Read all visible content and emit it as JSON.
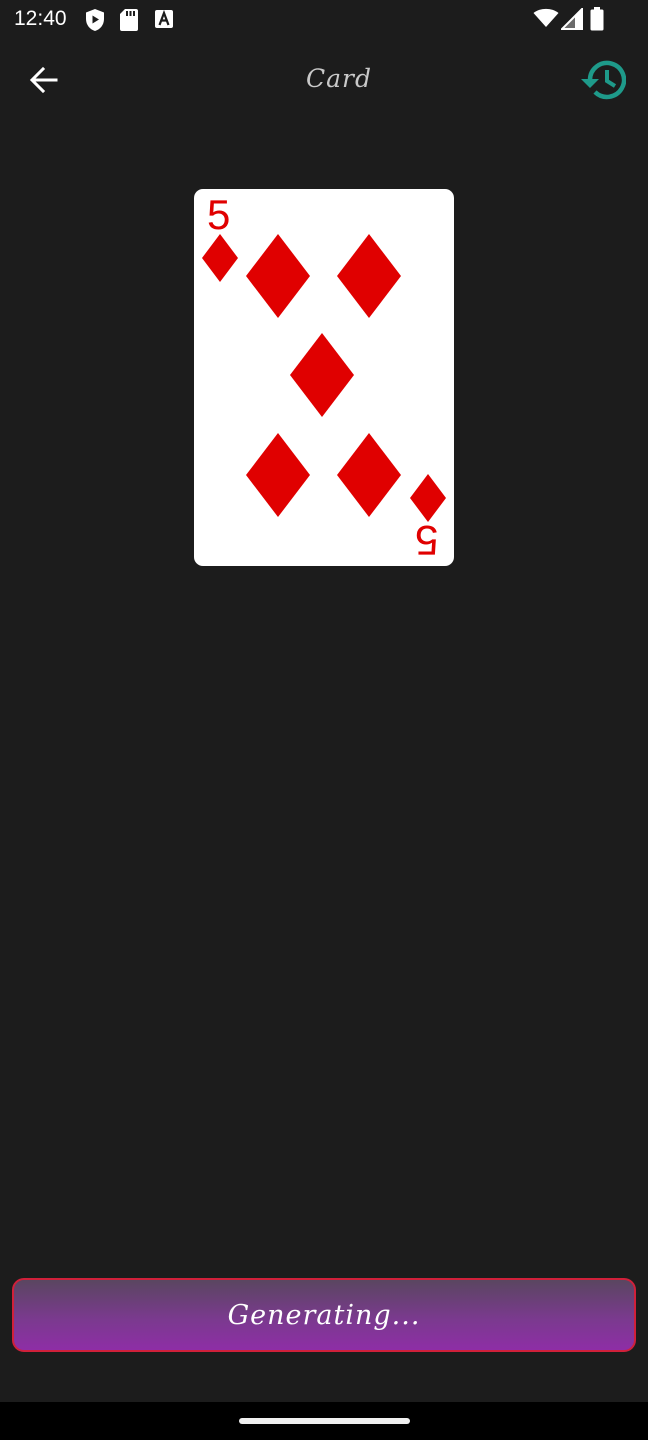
{
  "status_bar": {
    "time": "12:40",
    "left_icons": [
      "play-protect-icon",
      "sd-card-icon",
      "font-icon"
    ],
    "right_icons": [
      "wifi-icon",
      "cell-signal-icon",
      "battery-icon"
    ]
  },
  "app_bar": {
    "title": "Card",
    "back_icon": "arrow-left-icon",
    "history_icon": "history-icon",
    "accent_color": "#1e9a8a"
  },
  "card": {
    "rank": "5",
    "suit": "diamonds",
    "suit_color": "#e00000",
    "face_color": "#ffffff"
  },
  "generate_button": {
    "label": "Generating..."
  },
  "nav": {
    "home_indicator": "home-bar"
  }
}
